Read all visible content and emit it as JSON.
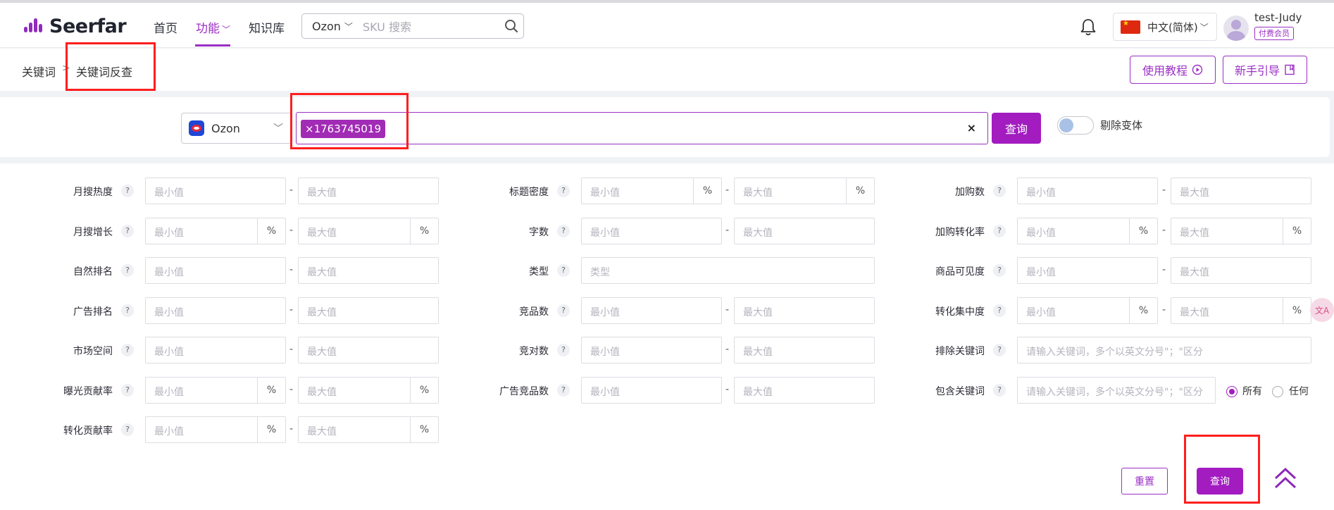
{
  "brand": {
    "logo_text": "Seerfar",
    "accent": "#a21cc0",
    "highlight": "#ff1e1e"
  },
  "nav": {
    "home": "首页",
    "features": "功能",
    "knowledge": "知识库"
  },
  "top_search": {
    "platform": "Ozon",
    "placeholder": "SKU 搜索",
    "icon": "search-icon"
  },
  "user": {
    "language": "中文(简体)",
    "name": "test-Judy",
    "badge": "付费会员",
    "notification_icon": "bell-icon"
  },
  "breadcrumb": {
    "parent": "关键词",
    "separator": ">",
    "current": "关键词反查"
  },
  "header_buttons": {
    "tutorial": "使用教程",
    "guide": "新手引导"
  },
  "search": {
    "platform": "Ozon",
    "tags": [
      "×1763745019"
    ],
    "clear": "×",
    "query_button": "查询",
    "toggle_label": "剔除变体",
    "toggle_on": false
  },
  "filters": {
    "min_ph": "最小值",
    "max_ph": "最大值",
    "pct": "%",
    "dash": "-",
    "qmark": "?",
    "col1": [
      {
        "label": "月搜热度",
        "pct": false
      },
      {
        "label": "月搜增长",
        "pct": true
      },
      {
        "label": "自然排名",
        "pct": false
      },
      {
        "label": "广告排名",
        "pct": false
      },
      {
        "label": "市场空间",
        "pct": false
      },
      {
        "label": "曝光贡献率",
        "pct": true
      },
      {
        "label": "转化贡献率",
        "pct": true
      }
    ],
    "col2": [
      {
        "label": "标题密度",
        "pct": true
      },
      {
        "label": "字数",
        "pct": false
      },
      {
        "label": "类型",
        "type_placeholder": "类型"
      },
      {
        "label": "竞品数",
        "pct": false
      },
      {
        "label": "竞对数",
        "pct": false
      },
      {
        "label": "广告竞品数",
        "pct": false
      }
    ],
    "col3": [
      {
        "label": "加购数",
        "pct": false
      },
      {
        "label": "加购转化率",
        "pct": true
      },
      {
        "label": "商品可见度",
        "pct": false
      },
      {
        "label": "转化集中度",
        "pct": true
      },
      {
        "label": "排除关键词",
        "kw_placeholder": "请输入关键词，多个以英文分号\"；\"区分"
      },
      {
        "label": "包含关键词",
        "kw_placeholder": "请输入关键词，多个以英文分号\"；\"区分"
      }
    ],
    "include_mode": {
      "all": "所有",
      "any": "任何",
      "selected": "all"
    }
  },
  "footer": {
    "reset": "重置",
    "query": "查询",
    "back_to_top_icon": "double-chevron-up-icon",
    "assistant_icon": "translate-icon"
  }
}
